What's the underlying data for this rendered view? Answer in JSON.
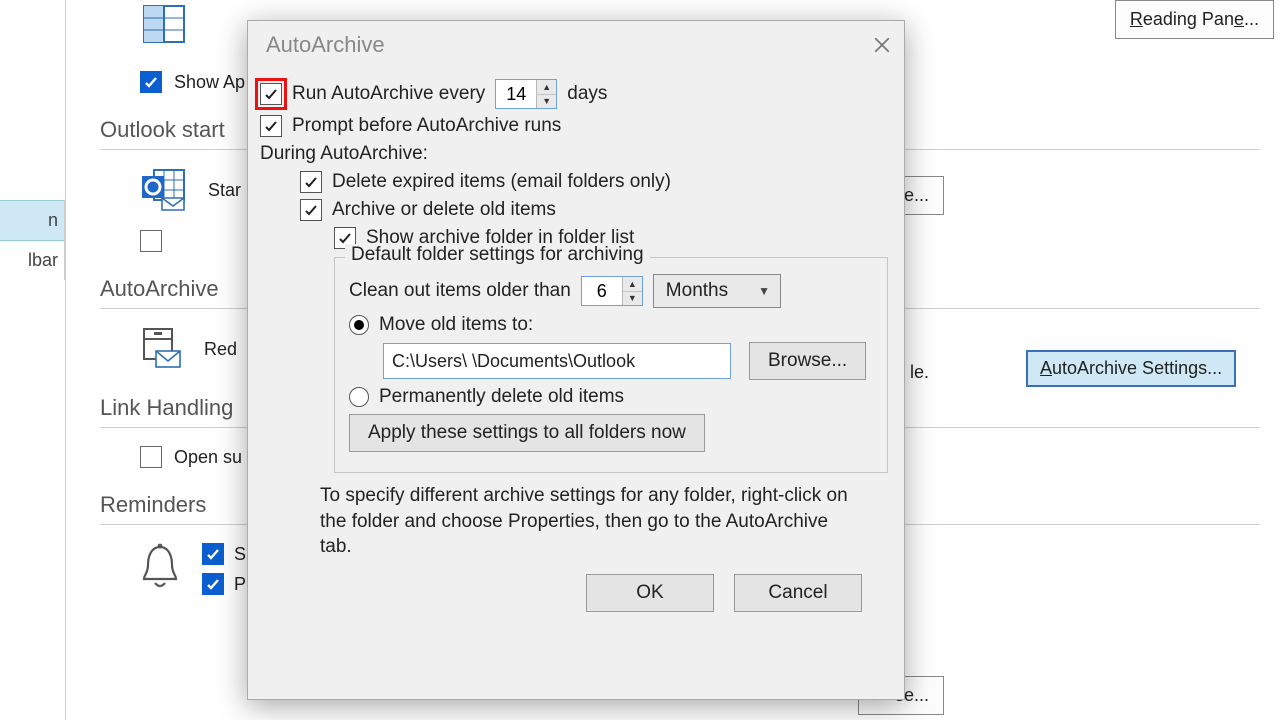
{
  "bg": {
    "nav": {
      "item1": "n",
      "item2": "lbar"
    },
    "showAp": "Show Ap",
    "section_outlook_start": "Outlook start",
    "star": "Star",
    "section_autoarchive": "AutoArchive",
    "red": "Red",
    "red_suffix": "le.",
    "section_link": "Link Handling",
    "open_su": "Open su",
    "section_reminders": "Reminders",
    "rem_s": "S",
    "rem_p": "P",
    "reading_pane_btn": "Reading Pane...",
    "autoarchive_btn": "AutoArchive Settings...",
    "cut_btn1": "e...",
    "cut_btn2": "se..."
  },
  "dlg": {
    "title": "AutoArchive",
    "run_every_pre": "Run AutoArchive every",
    "run_every_value": "14",
    "run_every_post": "days",
    "prompt": "Prompt before AutoArchive runs",
    "during": "During AutoArchive:",
    "delete_expired": "Delete expired items (email folders only)",
    "archive_delete": "Archive or delete old items",
    "show_archive_folder": "Show archive folder in folder list",
    "group_label": "Default folder settings for archiving",
    "clean_out_pre": "Clean out items older than",
    "clean_out_value": "6",
    "clean_out_unit": "Months",
    "move_old": "Move old items to:",
    "move_path": "C:\\Users\\        \\Documents\\Outlook",
    "browse": "Browse...",
    "perm_delete": "Permanently delete old items",
    "apply_all": "Apply these settings to all folders now",
    "note": "To specify different archive settings for any folder, right-click on the folder and choose Properties, then go to the AutoArchive tab.",
    "ok": "OK",
    "cancel": "Cancel"
  }
}
